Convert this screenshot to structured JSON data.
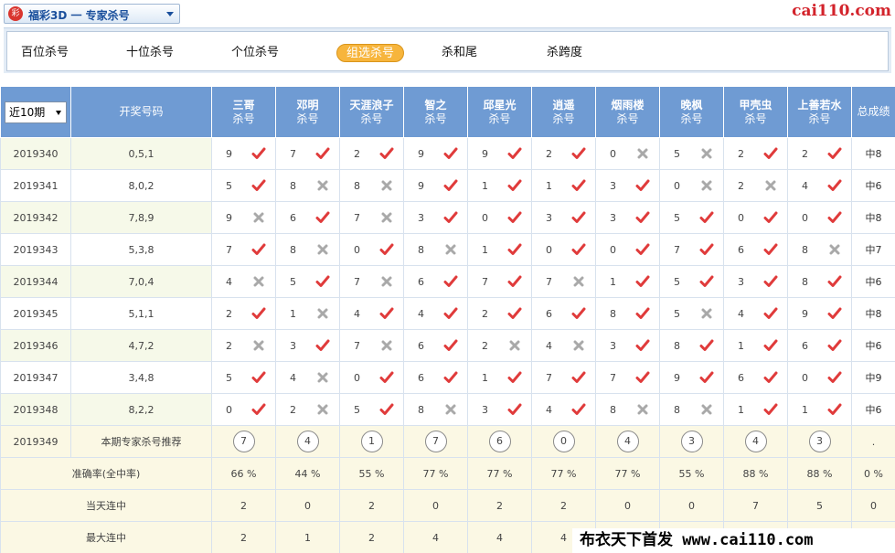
{
  "app": {
    "lottery_title": "福彩3D 一 专家杀号",
    "logo_char": "彩",
    "site_logo": "cai110.com"
  },
  "tabs": [
    "百位杀号",
    "十位杀号",
    "个位杀号",
    "组选杀号",
    "杀和尾",
    "杀跨度"
  ],
  "active_tab": "组选杀号",
  "period_select": "近10期",
  "header": {
    "draw_label": "开奖号码",
    "expert_sub": "杀号",
    "total_label": "总成绩",
    "experts": [
      "三哥",
      "邓明",
      "天涯浪子",
      "智之",
      "邱星光",
      "逍遥",
      "烟雨楼",
      "晚枫",
      "甲壳虫",
      "上善若水"
    ]
  },
  "rows": [
    {
      "issue": "2019340",
      "draw": "0,5,1",
      "cells": [
        [
          9,
          "hit"
        ],
        [
          7,
          "hit"
        ],
        [
          2,
          "hit"
        ],
        [
          9,
          "hit"
        ],
        [
          9,
          "hit"
        ],
        [
          2,
          "hit"
        ],
        [
          0,
          "miss"
        ],
        [
          5,
          "miss"
        ],
        [
          2,
          "hit"
        ],
        [
          2,
          "hit"
        ]
      ],
      "total": "中8"
    },
    {
      "issue": "2019341",
      "draw": "8,0,2",
      "cells": [
        [
          5,
          "hit"
        ],
        [
          8,
          "miss"
        ],
        [
          8,
          "miss"
        ],
        [
          9,
          "hit"
        ],
        [
          1,
          "hit"
        ],
        [
          1,
          "hit"
        ],
        [
          3,
          "hit"
        ],
        [
          0,
          "miss"
        ],
        [
          2,
          "miss"
        ],
        [
          4,
          "hit"
        ]
      ],
      "total": "中6"
    },
    {
      "issue": "2019342",
      "draw": "7,8,9",
      "cells": [
        [
          9,
          "miss"
        ],
        [
          6,
          "hit"
        ],
        [
          7,
          "miss"
        ],
        [
          3,
          "hit"
        ],
        [
          0,
          "hit"
        ],
        [
          3,
          "hit"
        ],
        [
          3,
          "hit"
        ],
        [
          5,
          "hit"
        ],
        [
          0,
          "hit"
        ],
        [
          0,
          "hit"
        ]
      ],
      "total": "中8"
    },
    {
      "issue": "2019343",
      "draw": "5,3,8",
      "cells": [
        [
          7,
          "hit"
        ],
        [
          8,
          "miss"
        ],
        [
          0,
          "hit"
        ],
        [
          8,
          "miss"
        ],
        [
          1,
          "hit"
        ],
        [
          0,
          "hit"
        ],
        [
          0,
          "hit"
        ],
        [
          7,
          "hit"
        ],
        [
          6,
          "hit"
        ],
        [
          8,
          "miss"
        ]
      ],
      "total": "中7"
    },
    {
      "issue": "2019344",
      "draw": "7,0,4",
      "cells": [
        [
          4,
          "miss"
        ],
        [
          5,
          "hit"
        ],
        [
          7,
          "miss"
        ],
        [
          6,
          "hit"
        ],
        [
          7,
          "hit"
        ],
        [
          7,
          "miss"
        ],
        [
          1,
          "hit"
        ],
        [
          5,
          "hit"
        ],
        [
          3,
          "hit"
        ],
        [
          8,
          "hit"
        ]
      ],
      "total": "中6"
    },
    {
      "issue": "2019345",
      "draw": "5,1,1",
      "cells": [
        [
          2,
          "hit"
        ],
        [
          1,
          "miss"
        ],
        [
          4,
          "hit"
        ],
        [
          4,
          "hit"
        ],
        [
          2,
          "hit"
        ],
        [
          6,
          "hit"
        ],
        [
          8,
          "hit"
        ],
        [
          5,
          "miss"
        ],
        [
          4,
          "hit"
        ],
        [
          9,
          "hit"
        ]
      ],
      "total": "中8"
    },
    {
      "issue": "2019346",
      "draw": "4,7,2",
      "cells": [
        [
          2,
          "miss"
        ],
        [
          3,
          "hit"
        ],
        [
          7,
          "miss"
        ],
        [
          6,
          "hit"
        ],
        [
          2,
          "miss"
        ],
        [
          4,
          "miss"
        ],
        [
          3,
          "hit"
        ],
        [
          8,
          "hit"
        ],
        [
          1,
          "hit"
        ],
        [
          6,
          "hit"
        ]
      ],
      "total": "中6"
    },
    {
      "issue": "2019347",
      "draw": "3,4,8",
      "cells": [
        [
          5,
          "hit"
        ],
        [
          4,
          "miss"
        ],
        [
          0,
          "hit"
        ],
        [
          6,
          "hit"
        ],
        [
          1,
          "hit"
        ],
        [
          7,
          "hit"
        ],
        [
          7,
          "hit"
        ],
        [
          9,
          "hit"
        ],
        [
          6,
          "hit"
        ],
        [
          0,
          "hit"
        ]
      ],
      "total": "中9"
    },
    {
      "issue": "2019348",
      "draw": "8,2,2",
      "cells": [
        [
          0,
          "hit"
        ],
        [
          2,
          "miss"
        ],
        [
          5,
          "hit"
        ],
        [
          8,
          "miss"
        ],
        [
          3,
          "hit"
        ],
        [
          4,
          "hit"
        ],
        [
          8,
          "miss"
        ],
        [
          8,
          "miss"
        ],
        [
          1,
          "hit"
        ],
        [
          1,
          "hit"
        ]
      ],
      "total": "中6"
    }
  ],
  "recommend": {
    "issue": "2019349",
    "label": "本期专家杀号推荐",
    "values": [
      "7",
      "4",
      "1",
      "7",
      "6",
      "0",
      "4",
      "3",
      "4",
      "3"
    ],
    "total": "."
  },
  "stats": [
    {
      "label": "准确率(全中率)",
      "values": [
        "66 %",
        "44 %",
        "55 %",
        "77 %",
        "77 %",
        "77 %",
        "77 %",
        "55 %",
        "88 %",
        "88 %"
      ],
      "total": "0 %"
    },
    {
      "label": "当天连中",
      "values": [
        "2",
        "0",
        "2",
        "0",
        "2",
        "2",
        "0",
        "0",
        "7",
        "5"
      ],
      "total": "0"
    },
    {
      "label": "最大连中",
      "values": [
        "2",
        "1",
        "2",
        "4",
        "4",
        "4",
        "",
        "",
        "",
        ""
      ],
      "total": ""
    }
  ],
  "watermark": "布衣天下首发 www.cai110.com",
  "colors": {
    "header_blue": "#6f9bd3",
    "hit_red": "#e03b3b",
    "miss_grey": "#a9a9a9",
    "active_tab": "#f7b53c"
  }
}
